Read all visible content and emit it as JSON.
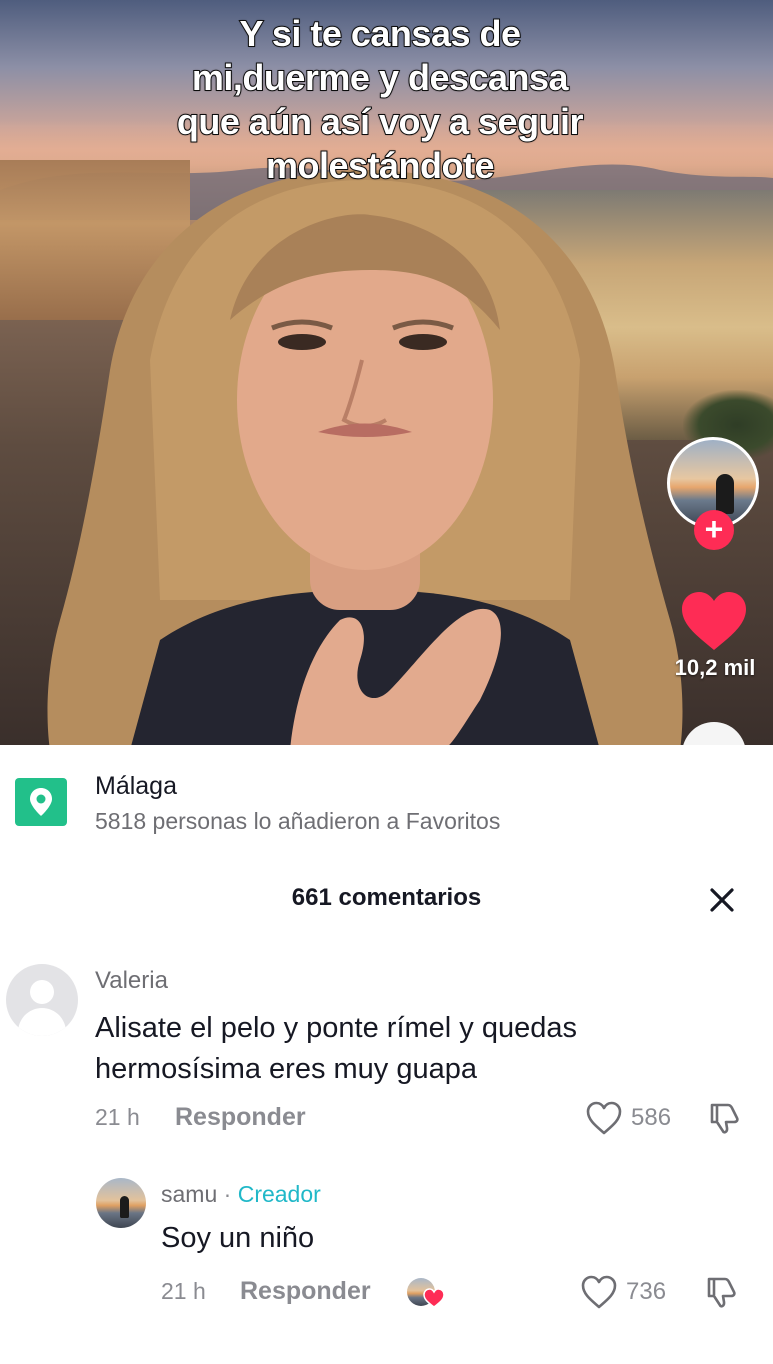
{
  "video": {
    "caption_lines": [
      "Y si te cansas de",
      "mi,duerme y descansa",
      "que aún así voy a seguir",
      "molestándote"
    ],
    "likes_count": "10,2 mil",
    "follow_symbol": "+"
  },
  "location": {
    "name": "Málaga",
    "favorites_text": "5818 personas lo añadieron a Favoritos",
    "icon": "location-pin-icon",
    "icon_color": "#22c08a"
  },
  "comments": {
    "title": "661 comentarios",
    "close_symbol": "✕",
    "items": [
      {
        "user": "Valeria",
        "text": "Alisate el pelo y ponte rímel y quedas hermosísima eres muy guapa",
        "time": "21 h",
        "reply_label": "Responder",
        "likes": "586"
      },
      {
        "user": "samu",
        "separator": "·",
        "badge": "Creador",
        "text": "Soy un niño",
        "time": "21 h",
        "reply_label": "Responder",
        "likes": "736",
        "creator_liked": true
      }
    ]
  },
  "colors": {
    "accent": "#fe2c55",
    "creator_badge": "#20b8c8",
    "muted": "#8a8b91"
  }
}
